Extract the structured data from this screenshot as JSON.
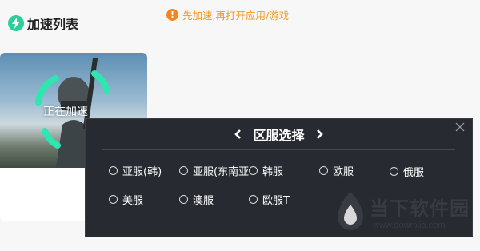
{
  "header": {
    "title": "加速列表",
    "notice": "先加速,再打开应用/游戏",
    "notice_icon": "!"
  },
  "game_card": {
    "status": "正在加速"
  },
  "region_dialog": {
    "title": "区服选择",
    "options": [
      {
        "label": "亚服(韩)"
      },
      {
        "label": "亚服(东南亚)"
      },
      {
        "label": "韩服"
      },
      {
        "label": "欧服"
      },
      {
        "label": "俄服"
      },
      {
        "label": "美服"
      },
      {
        "label": "澳服"
      },
      {
        "label": "欧服T"
      }
    ]
  },
  "watermark": {
    "name": "当下软件园",
    "url": "www.downxia.com"
  },
  "colors": {
    "accent": "#2bcf9a",
    "warning": "#f5851f",
    "dialog_bg": "#272a31"
  }
}
